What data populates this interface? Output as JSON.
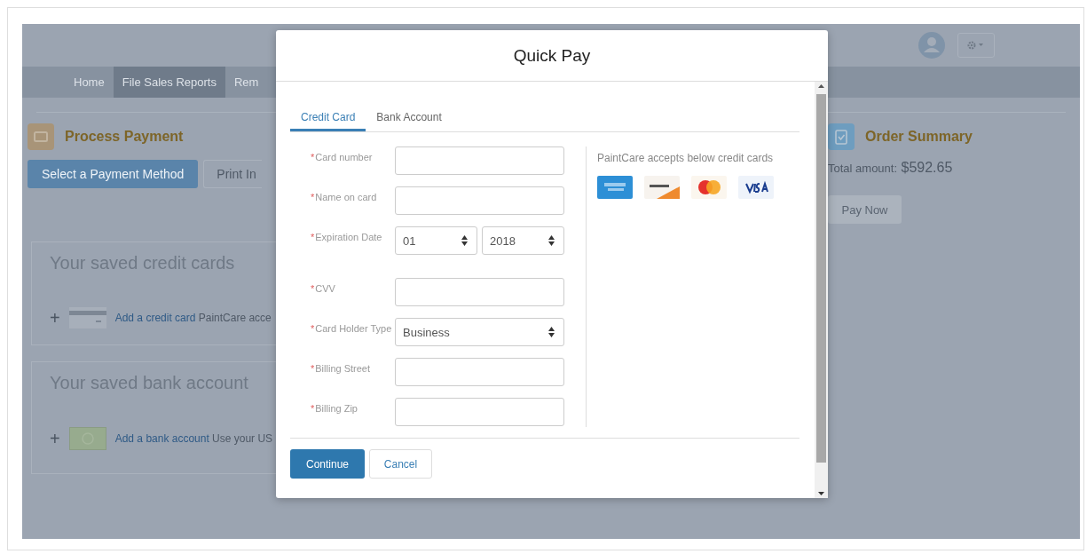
{
  "nav": [
    {
      "label": "Home",
      "selected": false
    },
    {
      "label": "File Sales Reports",
      "selected": true
    },
    {
      "label": "Rem",
      "selected": false
    }
  ],
  "process_payment": {
    "title": "Process Payment",
    "buttons": [
      {
        "label": "Select a Payment Method",
        "kind": "primary"
      },
      {
        "label": "Print In",
        "kind": "default"
      }
    ]
  },
  "saved_sections": [
    {
      "title": "Your saved credit cards",
      "kind": "card",
      "add_mark": "+",
      "link": "Add a credit card",
      "text": "PaintCare acce"
    },
    {
      "title": "Your saved bank account",
      "kind": "bank",
      "add_mark": "+",
      "link": "Add a bank account",
      "text": "Use your US"
    }
  ],
  "order_summary": {
    "title": "Order Summary",
    "total_label": "Total amount:",
    "total": "$592.65",
    "button": {
      "label": "Pay Now",
      "disabled": true
    }
  },
  "modal": {
    "title": "Quick Pay",
    "tabs": [
      {
        "label": "Credit Card",
        "selected": true
      },
      {
        "label": "Bank Account",
        "selected": false
      }
    ],
    "required_mark": "*",
    "fields": [
      {
        "label": "Card number",
        "required": true,
        "kind": "text"
      },
      {
        "label": "Name on card",
        "required": true,
        "kind": "text"
      },
      {
        "label": "Expiration Date",
        "required": true,
        "kind": "pair",
        "values": [
          "01",
          "2018"
        ]
      },
      {
        "label": "CVV",
        "required": true,
        "kind": "text"
      },
      {
        "label": "Card Holder Type",
        "required": true,
        "kind": "select",
        "value": "Business"
      },
      {
        "label": "Billing Street",
        "required": true,
        "kind": "text"
      },
      {
        "label": "Billing Zip",
        "required": true,
        "kind": "text"
      }
    ],
    "accepts_text": "PaintCare accepts below credit cards",
    "buttons": [
      {
        "label": "Continue",
        "kind": "primary"
      },
      {
        "label": "Cancel",
        "kind": "default"
      }
    ]
  }
}
